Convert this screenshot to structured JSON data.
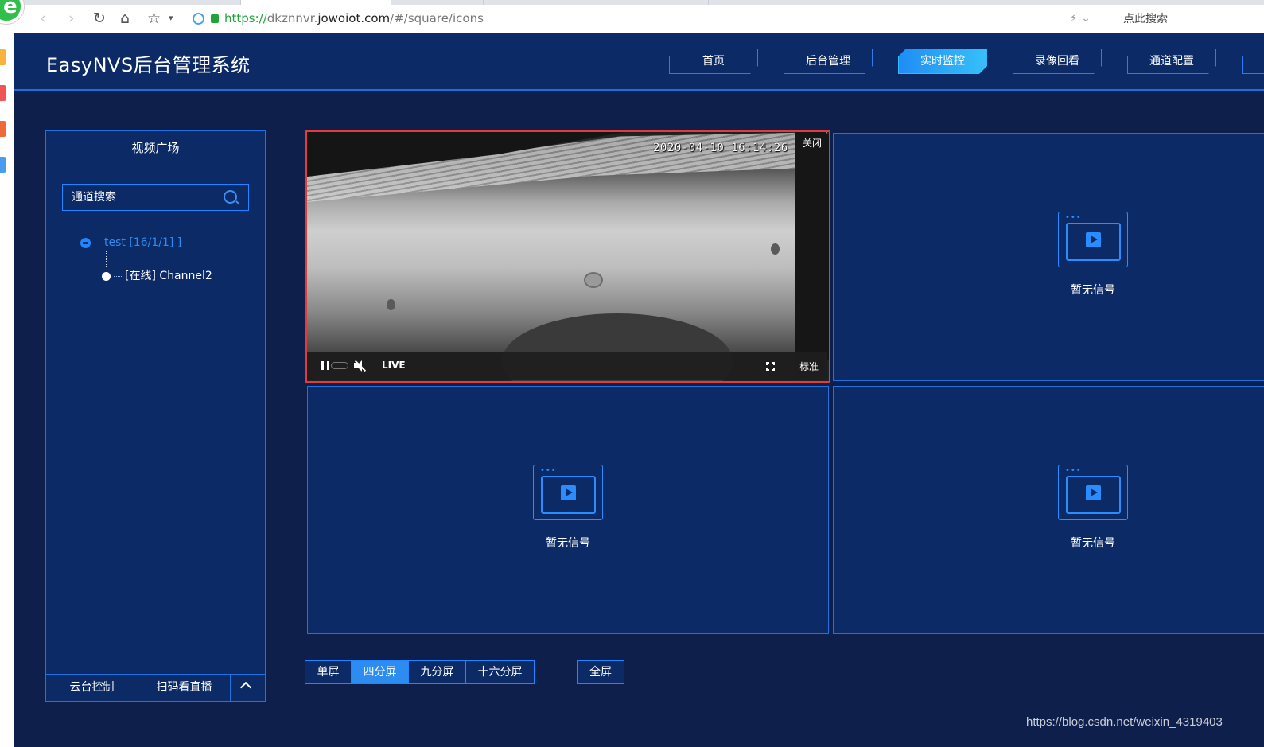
{
  "browser": {
    "url_protocol": "https://",
    "url_host_prefix": "dkznnvr.",
    "url_host": "jowoiot.com",
    "url_path": "/#/square/icons",
    "search_placeholder": "点此搜索",
    "back_icon": "chevron-left-icon",
    "forward_icon": "chevron-right-icon",
    "reload_icon": "reload-icon",
    "home_icon": "home-icon",
    "favorite_icon": "star-icon",
    "logo_letter": "e"
  },
  "header": {
    "title": "EasyNVS后台管理系统",
    "nav": [
      {
        "label": "首页",
        "active": false
      },
      {
        "label": "后台管理",
        "active": false
      },
      {
        "label": "实时监控",
        "active": true
      },
      {
        "label": "录像回看",
        "active": false
      },
      {
        "label": "通道配置",
        "active": false
      }
    ]
  },
  "sidebar": {
    "title": "视频广场",
    "search_placeholder": "通道搜索",
    "tree": {
      "group_label": "test [16/1/1] ]",
      "channel_label": "[在线] Channel2"
    },
    "footer": {
      "ptz_label": "云台控制",
      "qr_label": "扫码看直播"
    }
  },
  "player": {
    "timestamp": "2020-04-10 16:14:26",
    "close_label": "关闭",
    "live_label": "LIVE",
    "quality_label": "标准",
    "no_signal_label": "暂无信号"
  },
  "layout_switch": {
    "options": [
      "单屏",
      "四分屏",
      "九分屏",
      "十六分屏"
    ],
    "active": "四分屏",
    "fullscreen_label": "全屏"
  },
  "watermark": "https://blog.csdn.net/weixin_4319403",
  "colors": {
    "header_bg": "#0c2a66",
    "page_bg": "#0f1f4b",
    "accent": "#2d8cf0",
    "selected_border": "#e23b3b"
  }
}
